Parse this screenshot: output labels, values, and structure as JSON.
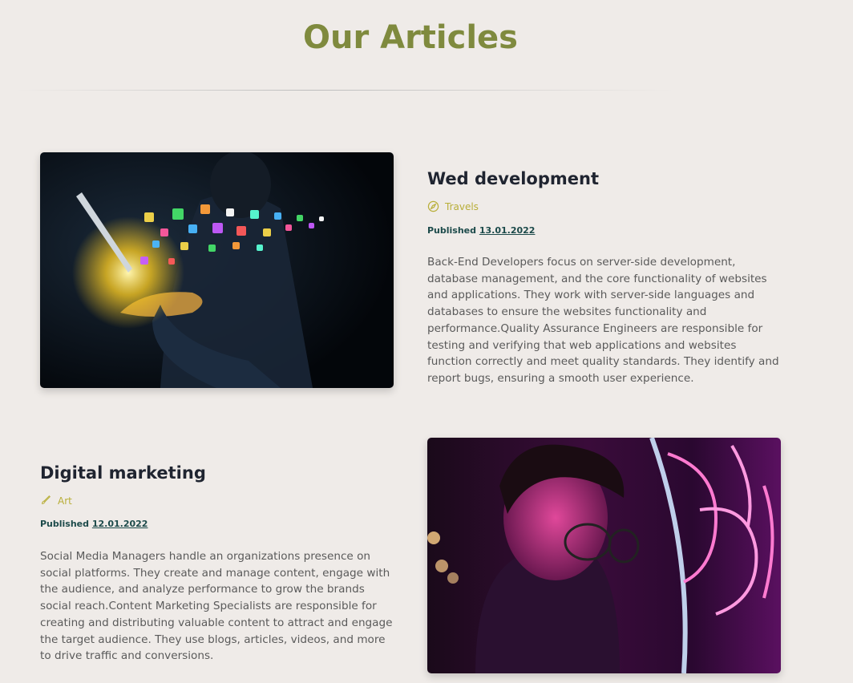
{
  "page": {
    "title": "Our Articles"
  },
  "articles": [
    {
      "title": "Wed development",
      "category": "Travels",
      "category_icon": "compass-icon",
      "published_label": "Published",
      "published_date": "13.01.2022",
      "body": "Back-End Developers focus on server-side development, database management, and the core functionality of websites and applications. They work with server-side languages and databases to ensure the websites functionality and performance.Quality Assurance Engineers are responsible for testing and verifying that web applications and websites function correctly and meet quality standards. They identify and report bugs, ensuring a smooth user experience."
    },
    {
      "title": "Digital marketing",
      "category": "Art",
      "category_icon": "brush-icon",
      "published_label": "Published",
      "published_date": "12.01.2022",
      "body": "Social Media Managers handle an organizations presence on social platforms. They create and manage content, engage with the audience, and analyze performance to grow the brands social reach.Content Marketing Specialists are responsible for creating and distributing valuable content to attract and engage the target audience. They use blogs, articles, videos, and more to drive traffic and conversions."
    }
  ],
  "colors": {
    "background": "#efebe8",
    "title": "#7f8a3e",
    "category": "#b8ae38",
    "published": "#1c4a4a",
    "heading": "#1f2430",
    "body": "#5a5a5a"
  }
}
